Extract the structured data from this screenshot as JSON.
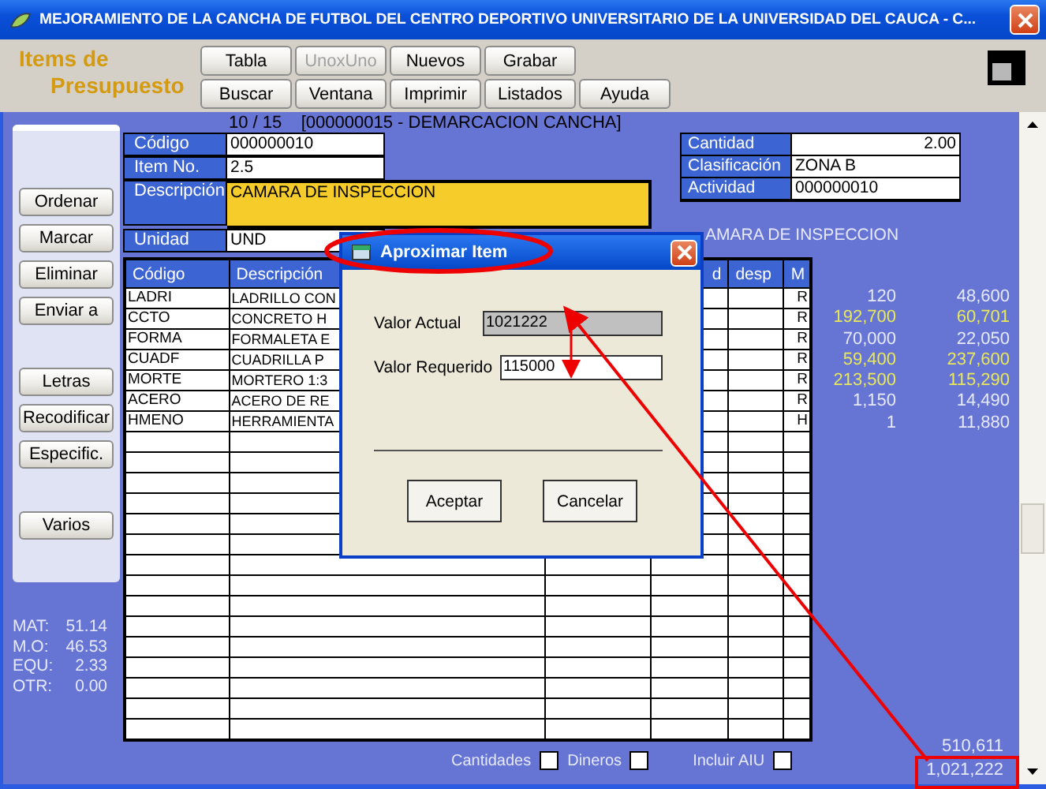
{
  "window": {
    "title": "MEJORAMIENTO DE LA CANCHA DE FUTBOL DEL CENTRO DEPORTIVO UNIVERSITARIO DE LA UNIVERSIDAD DEL CAUCA - C..."
  },
  "header": {
    "title_line_1": "Items de",
    "title_line_2": "Presupuesto"
  },
  "toolbar": [
    [
      {
        "label": "Tabla",
        "disabled": false
      },
      {
        "label": "UnoxUno",
        "disabled": true
      },
      {
        "label": "Nuevos",
        "disabled": false
      },
      {
        "label": "Grabar",
        "disabled": false
      }
    ],
    [
      {
        "label": "Buscar",
        "disabled": false
      },
      {
        "label": "Ventana",
        "disabled": false
      },
      {
        "label": "Imprimir",
        "disabled": false
      },
      {
        "label": "Listados",
        "disabled": false
      },
      {
        "label": "Ayuda",
        "disabled": false
      }
    ]
  ],
  "sidebar": {
    "groups": [
      [
        "Ordenar",
        "Marcar",
        "Eliminar",
        "Enviar a"
      ],
      [
        "Letras",
        "Recodificar",
        "Especific."
      ],
      [
        "Varios"
      ]
    ],
    "stats": [
      {
        "label": "MAT:",
        "value": "51.14"
      },
      {
        "label": "M.O:",
        "value": "46.53"
      },
      {
        "label": "EQU:",
        "value": "2.33"
      },
      {
        "label": "OTR:",
        "value": "0.00"
      }
    ]
  },
  "record": {
    "caption": "10 / 15    [000000015 - DEMARCACION CANCHA]",
    "fields": [
      {
        "label": "Código",
        "value": "000000010",
        "kind": "short"
      },
      {
        "label": "Item No.",
        "value": "2.5",
        "kind": "short"
      },
      {
        "label": "Descripción",
        "value": "CAMARA DE INSPECCION",
        "kind": "long"
      },
      {
        "label": "Unidad",
        "value": "UND",
        "kind": "short"
      }
    ],
    "side_fields": [
      {
        "label": "Cantidad",
        "value": "2.00",
        "kind": "number"
      },
      {
        "label": "Clasificación",
        "value": "ZONA B",
        "kind": "text"
      },
      {
        "label": "Actividad",
        "value": "000000010",
        "kind": "text"
      }
    ],
    "heading": "AMARA DE INSPECCION"
  },
  "table": {
    "columns": [
      "Código",
      "Descripción",
      "",
      "d",
      "desp",
      "M"
    ],
    "rows": [
      {
        "code": "LADRI",
        "description": "LADRILLO CON",
        "m": "R",
        "column_7": "120",
        "column_8": "48,600",
        "highlighted": false
      },
      {
        "code": "CCTO",
        "description": "CONCRETO H",
        "m": "R",
        "column_7": "192,700",
        "column_8": "60,701",
        "highlighted": true
      },
      {
        "code": "FORMA",
        "description": "FORMALETA E",
        "m": "R",
        "column_7": "70,000",
        "column_8": "22,050",
        "highlighted": false
      },
      {
        "code": "CUADF",
        "description": "CUADRILLA P",
        "m": "R",
        "column_7": "59,400",
        "column_8": "237,600",
        "highlighted": true
      },
      {
        "code": "MORTE",
        "description": "MORTERO 1:3",
        "m": "R",
        "column_7": "213,500",
        "column_8": "115,290",
        "highlighted": true
      },
      {
        "code": "ACERO",
        "description": "ACERO DE RE",
        "m": "R",
        "column_7": "1,150",
        "column_8": "14,490",
        "highlighted": false
      },
      {
        "code": "HMENO",
        "description": "HERRAMIENTA",
        "m": "H",
        "column_7": "1",
        "column_8": "11,880",
        "highlighted": false
      }
    ]
  },
  "options": [
    {
      "label": "Cantidades",
      "checked": false
    },
    {
      "label": "Dineros",
      "checked": false
    },
    {
      "label": "Incluir AIU",
      "checked": false
    }
  ],
  "totals": [
    "510,611",
    "1,021,222"
  ],
  "dialog": {
    "title": "Aproximar Item",
    "fields": [
      {
        "label": "Valor Actual",
        "value": "1021222",
        "disabled": true
      },
      {
        "label": "Valor Requerido",
        "value": "115000",
        "disabled": false
      }
    ],
    "buttons": [
      "Aceptar",
      "Cancelar"
    ]
  }
}
